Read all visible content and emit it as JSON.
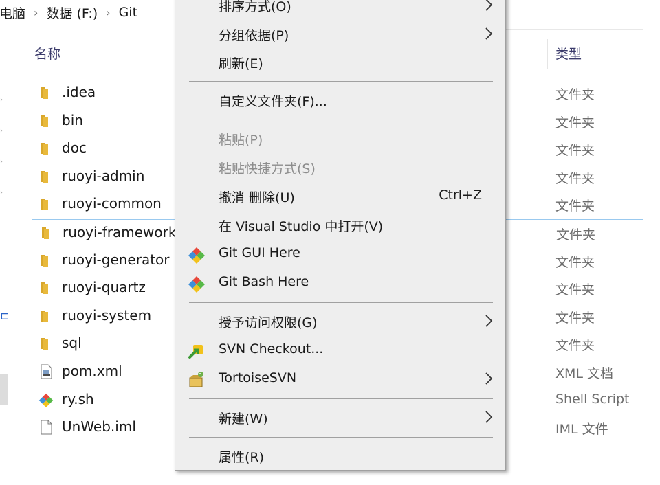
{
  "breadcrumb": {
    "items": [
      "此电脑",
      "数据 (F:)",
      "Git"
    ],
    "separator": "›"
  },
  "columns": {
    "name": "名称",
    "type": "类型"
  },
  "files": [
    {
      "name": ".idea",
      "type": "文件夹",
      "icon": "folder-icon"
    },
    {
      "name": "bin",
      "type": "文件夹",
      "icon": "folder-icon"
    },
    {
      "name": "doc",
      "type": "文件夹",
      "icon": "folder-icon"
    },
    {
      "name": "ruoyi-admin",
      "type": "文件夹",
      "icon": "folder-icon"
    },
    {
      "name": "ruoyi-common",
      "type": "文件夹",
      "icon": "folder-icon"
    },
    {
      "name": "ruoyi-framework",
      "type": "文件夹",
      "icon": "folder-icon",
      "selected": true
    },
    {
      "name": "ruoyi-generator",
      "type": "文件夹",
      "icon": "folder-icon"
    },
    {
      "name": "ruoyi-quartz",
      "type": "文件夹",
      "icon": "folder-icon"
    },
    {
      "name": "ruoyi-system",
      "type": "文件夹",
      "icon": "folder-icon"
    },
    {
      "name": "sql",
      "type": "文件夹",
      "icon": "folder-icon"
    },
    {
      "name": "pom.xml",
      "type": "XML 文档",
      "icon": "xml-file-icon"
    },
    {
      "name": "ry.sh",
      "type": "Shell Script",
      "icon": "git-script-icon"
    },
    {
      "name": "UnWeb.iml",
      "type": "IML 文件",
      "icon": "blank-file-icon"
    }
  ],
  "context_menu": {
    "items": [
      {
        "label": "排序方式(O)",
        "submenu": true
      },
      {
        "label": "分组依据(P)",
        "submenu": true
      },
      {
        "label": "刷新(E)"
      },
      {
        "separator": true
      },
      {
        "label": "自定义文件夹(F)..."
      },
      {
        "separator": true
      },
      {
        "label": "粘贴(P)",
        "disabled": true
      },
      {
        "label": "粘贴快捷方式(S)",
        "disabled": true
      },
      {
        "label": "撤消 删除(U)",
        "shortcut": "Ctrl+Z"
      },
      {
        "label": "在 Visual Studio 中打开(V)"
      },
      {
        "label": "Git GUI Here",
        "icon": "git-icon"
      },
      {
        "label": "Git Bash Here",
        "icon": "git-icon"
      },
      {
        "separator": true
      },
      {
        "label": "授予访问权限(G)",
        "submenu": true
      },
      {
        "label": "SVN Checkout...",
        "icon": "svn-checkout-icon"
      },
      {
        "label": "TortoiseSVN",
        "icon": "tortoisesvn-icon",
        "submenu": true
      },
      {
        "separator": true
      },
      {
        "label": "新建(W)",
        "submenu": true
      },
      {
        "separator": true
      },
      {
        "label": "属性(R)"
      }
    ]
  },
  "colors": {
    "folder": "#e8b93c",
    "selection_border": "#99c9ef",
    "menu_bg": "#eeeeee",
    "git_red": "#e8483a",
    "git_blue": "#3f8fd8",
    "git_green": "#57b947",
    "git_yellow": "#f2c21b"
  }
}
